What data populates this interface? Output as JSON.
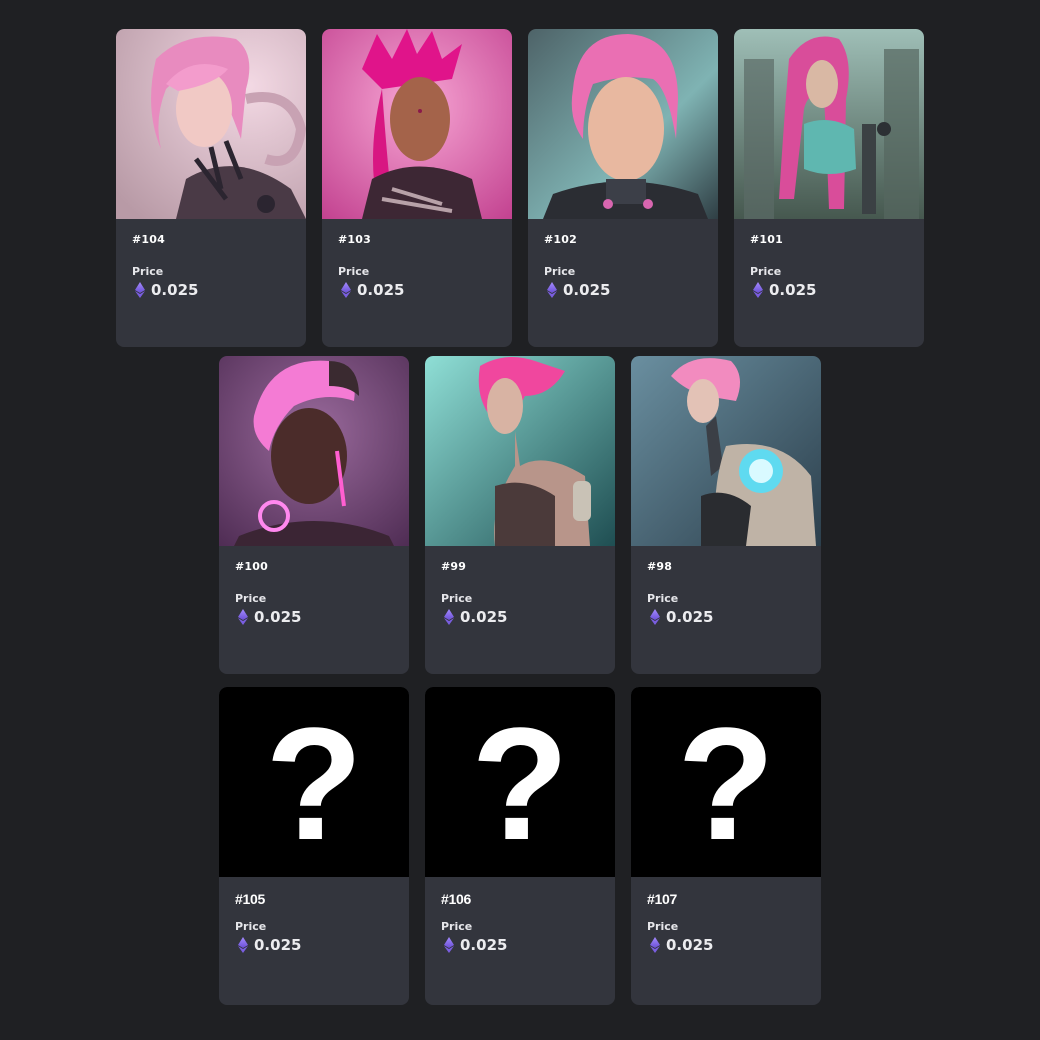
{
  "colors": {
    "background": "#1f2023",
    "card": "#33353d",
    "text": "#ffffff",
    "eth_icon": "#8a6cf0"
  },
  "price_label": "Price",
  "currency_icon": "ethereum-icon",
  "cards": [
    {
      "id": "#104",
      "price": "0.025",
      "image": "pink-haired-cyborg-portrait"
    },
    {
      "id": "#103",
      "price": "0.025",
      "image": "pink-mohawk-cyborg-portrait"
    },
    {
      "id": "#102",
      "price": "0.025",
      "image": "pink-bob-cyborg-portrait"
    },
    {
      "id": "#101",
      "price": "0.025",
      "image": "pink-long-hair-android-city"
    },
    {
      "id": "#100",
      "price": "0.025",
      "image": "glowing-pink-cyborg-portrait"
    },
    {
      "id": "#99",
      "price": "0.025",
      "image": "pink-haired-teal-cyborg"
    },
    {
      "id": "#98",
      "price": "0.025",
      "image": "pink-haired-mech-arm-cyborg"
    },
    {
      "id": "#105",
      "price": "0.025",
      "image": "mystery-question-mark",
      "mark": "?"
    },
    {
      "id": "#106",
      "price": "0.025",
      "image": "mystery-question-mark",
      "mark": "?"
    },
    {
      "id": "#107",
      "price": "0.025",
      "image": "mystery-question-mark",
      "mark": "?"
    }
  ]
}
